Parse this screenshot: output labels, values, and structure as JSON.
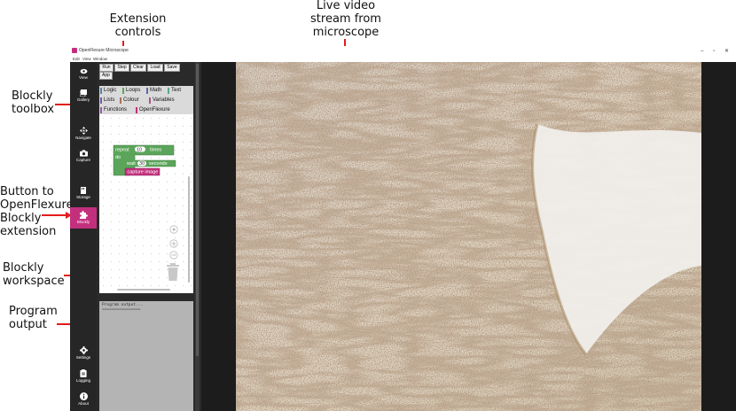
{
  "annotations": {
    "extension_controls": [
      "Extension",
      "controls"
    ],
    "live_video": [
      "Live video",
      "stream from",
      "microscope"
    ],
    "blockly_toolbox": [
      "Blockly",
      "toolbox"
    ],
    "button_to_extension": [
      "Button to",
      "OpenFlexure",
      "Blockly",
      "extension"
    ],
    "blockly_workspace": [
      "Blockly",
      "workspace"
    ],
    "program_output": [
      "Program",
      "output"
    ]
  },
  "window": {
    "title": "OpenFlexure Microscope",
    "controls": [
      "–",
      "▫",
      "✕"
    ]
  },
  "menubar": [
    "Edit",
    "View",
    "Window"
  ],
  "sidebar": {
    "items": [
      {
        "label": "View",
        "icon": "eye-icon"
      },
      {
        "label": "Gallery",
        "icon": "gallery-icon"
      },
      {
        "label": "Navigate",
        "icon": "move-icon"
      },
      {
        "label": "Capture",
        "icon": "camera-icon"
      },
      {
        "label": "Storage",
        "icon": "storage-icon"
      },
      {
        "label": "Blockly",
        "icon": "puzzle-icon",
        "active": true
      },
      {
        "label": "Settings",
        "icon": "gear-icon"
      },
      {
        "label": "Logging",
        "icon": "clipboard-icon"
      },
      {
        "label": "About",
        "icon": "info-icon"
      }
    ],
    "active_color": "#c2307d"
  },
  "extension_controls": {
    "buttons": [
      "Run",
      "Step",
      "Clear",
      "Load",
      "Save",
      "App"
    ]
  },
  "toolbox": {
    "categories": [
      {
        "label": "Logic",
        "color": "#5b80a5"
      },
      {
        "label": "Loops",
        "color": "#5ba55b"
      },
      {
        "label": "Math",
        "color": "#5b67a5"
      },
      {
        "label": "Text",
        "color": "#5ba58c"
      },
      {
        "label": "Lists",
        "color": "#745ba5"
      },
      {
        "label": "Colour",
        "color": "#a5745b"
      },
      {
        "label": "Variables",
        "color": "#a55b80"
      },
      {
        "label": "Functions",
        "color": "#995ba5"
      },
      {
        "label": "OpenFlexure",
        "color": "#c2307d"
      }
    ]
  },
  "workspace": {
    "repeat_block": {
      "keyword": "repeat",
      "count": "10",
      "suffix": "times",
      "do": "do"
    },
    "wait_block": {
      "keyword": "wait",
      "value": "30",
      "suffix": "seconds"
    },
    "capture_block": {
      "label": "capture image"
    },
    "loop_color": "#5ba55b",
    "capture_color": "#c2307d"
  },
  "output": {
    "lines": [
      "Program output...",
      "================"
    ]
  }
}
